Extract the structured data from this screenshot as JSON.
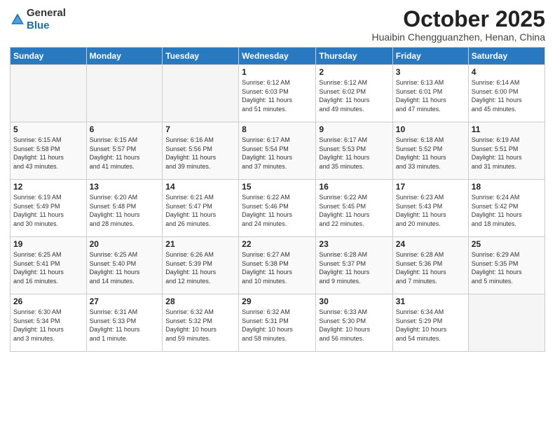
{
  "logo": {
    "general": "General",
    "blue": "Blue"
  },
  "header": {
    "month": "October 2025",
    "location": "Huaibin Chengguanzhen, Henan, China"
  },
  "weekdays": [
    "Sunday",
    "Monday",
    "Tuesday",
    "Wednesday",
    "Thursday",
    "Friday",
    "Saturday"
  ],
  "weeks": [
    [
      {
        "day": "",
        "info": ""
      },
      {
        "day": "",
        "info": ""
      },
      {
        "day": "",
        "info": ""
      },
      {
        "day": "1",
        "info": "Sunrise: 6:12 AM\nSunset: 6:03 PM\nDaylight: 11 hours\nand 51 minutes."
      },
      {
        "day": "2",
        "info": "Sunrise: 6:12 AM\nSunset: 6:02 PM\nDaylight: 11 hours\nand 49 minutes."
      },
      {
        "day": "3",
        "info": "Sunrise: 6:13 AM\nSunset: 6:01 PM\nDaylight: 11 hours\nand 47 minutes."
      },
      {
        "day": "4",
        "info": "Sunrise: 6:14 AM\nSunset: 6:00 PM\nDaylight: 11 hours\nand 45 minutes."
      }
    ],
    [
      {
        "day": "5",
        "info": "Sunrise: 6:15 AM\nSunset: 5:58 PM\nDaylight: 11 hours\nand 43 minutes."
      },
      {
        "day": "6",
        "info": "Sunrise: 6:15 AM\nSunset: 5:57 PM\nDaylight: 11 hours\nand 41 minutes."
      },
      {
        "day": "7",
        "info": "Sunrise: 6:16 AM\nSunset: 5:56 PM\nDaylight: 11 hours\nand 39 minutes."
      },
      {
        "day": "8",
        "info": "Sunrise: 6:17 AM\nSunset: 5:54 PM\nDaylight: 11 hours\nand 37 minutes."
      },
      {
        "day": "9",
        "info": "Sunrise: 6:17 AM\nSunset: 5:53 PM\nDaylight: 11 hours\nand 35 minutes."
      },
      {
        "day": "10",
        "info": "Sunrise: 6:18 AM\nSunset: 5:52 PM\nDaylight: 11 hours\nand 33 minutes."
      },
      {
        "day": "11",
        "info": "Sunrise: 6:19 AM\nSunset: 5:51 PM\nDaylight: 11 hours\nand 31 minutes."
      }
    ],
    [
      {
        "day": "12",
        "info": "Sunrise: 6:19 AM\nSunset: 5:49 PM\nDaylight: 11 hours\nand 30 minutes."
      },
      {
        "day": "13",
        "info": "Sunrise: 6:20 AM\nSunset: 5:48 PM\nDaylight: 11 hours\nand 28 minutes."
      },
      {
        "day": "14",
        "info": "Sunrise: 6:21 AM\nSunset: 5:47 PM\nDaylight: 11 hours\nand 26 minutes."
      },
      {
        "day": "15",
        "info": "Sunrise: 6:22 AM\nSunset: 5:46 PM\nDaylight: 11 hours\nand 24 minutes."
      },
      {
        "day": "16",
        "info": "Sunrise: 6:22 AM\nSunset: 5:45 PM\nDaylight: 11 hours\nand 22 minutes."
      },
      {
        "day": "17",
        "info": "Sunrise: 6:23 AM\nSunset: 5:43 PM\nDaylight: 11 hours\nand 20 minutes."
      },
      {
        "day": "18",
        "info": "Sunrise: 6:24 AM\nSunset: 5:42 PM\nDaylight: 11 hours\nand 18 minutes."
      }
    ],
    [
      {
        "day": "19",
        "info": "Sunrise: 6:25 AM\nSunset: 5:41 PM\nDaylight: 11 hours\nand 16 minutes."
      },
      {
        "day": "20",
        "info": "Sunrise: 6:25 AM\nSunset: 5:40 PM\nDaylight: 11 hours\nand 14 minutes."
      },
      {
        "day": "21",
        "info": "Sunrise: 6:26 AM\nSunset: 5:39 PM\nDaylight: 11 hours\nand 12 minutes."
      },
      {
        "day": "22",
        "info": "Sunrise: 6:27 AM\nSunset: 5:38 PM\nDaylight: 11 hours\nand 10 minutes."
      },
      {
        "day": "23",
        "info": "Sunrise: 6:28 AM\nSunset: 5:37 PM\nDaylight: 11 hours\nand 9 minutes."
      },
      {
        "day": "24",
        "info": "Sunrise: 6:28 AM\nSunset: 5:36 PM\nDaylight: 11 hours\nand 7 minutes."
      },
      {
        "day": "25",
        "info": "Sunrise: 6:29 AM\nSunset: 5:35 PM\nDaylight: 11 hours\nand 5 minutes."
      }
    ],
    [
      {
        "day": "26",
        "info": "Sunrise: 6:30 AM\nSunset: 5:34 PM\nDaylight: 11 hours\nand 3 minutes."
      },
      {
        "day": "27",
        "info": "Sunrise: 6:31 AM\nSunset: 5:33 PM\nDaylight: 11 hours\nand 1 minute."
      },
      {
        "day": "28",
        "info": "Sunrise: 6:32 AM\nSunset: 5:32 PM\nDaylight: 10 hours\nand 59 minutes."
      },
      {
        "day": "29",
        "info": "Sunrise: 6:32 AM\nSunset: 5:31 PM\nDaylight: 10 hours\nand 58 minutes."
      },
      {
        "day": "30",
        "info": "Sunrise: 6:33 AM\nSunset: 5:30 PM\nDaylight: 10 hours\nand 56 minutes."
      },
      {
        "day": "31",
        "info": "Sunrise: 6:34 AM\nSunset: 5:29 PM\nDaylight: 10 hours\nand 54 minutes."
      },
      {
        "day": "",
        "info": ""
      }
    ]
  ]
}
